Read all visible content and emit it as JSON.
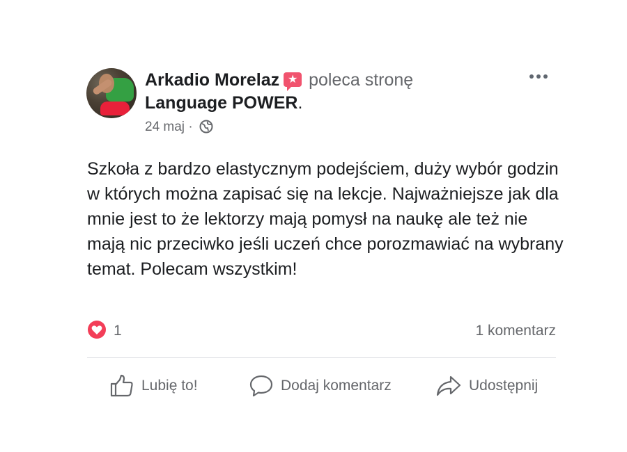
{
  "post": {
    "author": "Arkadio Morelaz",
    "badge_icon": "recommend-badge-icon",
    "recommends_text": "poleca stronę",
    "page_name": "Language POWER",
    "page_suffix": ".",
    "date": "24 maj",
    "separator": "·",
    "privacy_icon": "globe-icon",
    "text": "Szkoła z bardzo elastycznym podejściem, duży wybór godzin w których można zapisać się na lekcje. Najważniejsze jak dla mnie jest to że lektorzy mają pomysł na naukę ale też nie mają nic przeciwko jeśli uczeń chce porozmawiać na wybrany temat. Polecam wszystkim!"
  },
  "stats": {
    "reaction_icon": "heart-reaction-icon",
    "reaction_count": "1",
    "comments": "1 komentarz"
  },
  "actions": {
    "like": "Lubię to!",
    "comment": "Dodaj komentarz",
    "share": "Udostępnij"
  },
  "colors": {
    "text_primary": "#1c1e21",
    "text_secondary": "#65676b",
    "badge": "#f1536e",
    "love_reaction": "#f33e58",
    "divider": "#dadde1"
  }
}
